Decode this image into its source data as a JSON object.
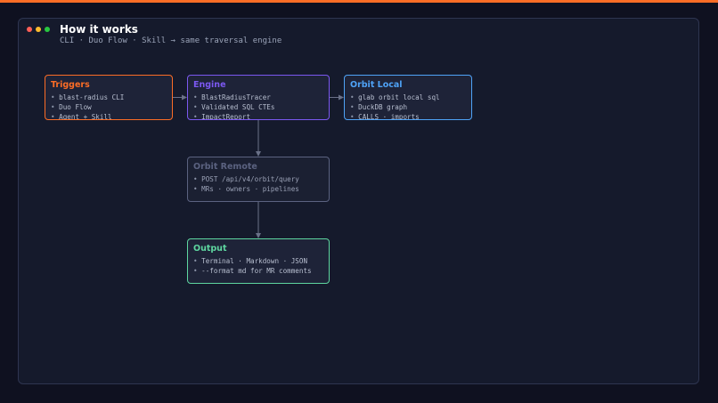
{
  "header": {
    "title": "How it works",
    "subtitle": "CLI · Duo Flow · Skill → same traversal engine"
  },
  "window_dots": [
    {
      "name": "close-dot",
      "color": "#ff5f57"
    },
    {
      "name": "minimize-dot",
      "color": "#febc2e"
    },
    {
      "name": "maximize-dot",
      "color": "#28c840"
    }
  ],
  "nodes": {
    "triggers": {
      "title": "Triggers",
      "color": "#fc6d26",
      "items": [
        "blast-radius CLI",
        "Duo Flow",
        "Agent + Skill"
      ]
    },
    "engine": {
      "title": "Engine",
      "color": "#7b58f0",
      "items": [
        "BlastRadiusTracer",
        "Validated SQL CTEs",
        "ImpactReport"
      ]
    },
    "orbit_local": {
      "title": "Orbit Local",
      "color": "#4fa3f7",
      "items": [
        "glab orbit local sql",
        "DuckDB graph",
        "CALLS · imports"
      ]
    },
    "orbit_remote": {
      "title": "Orbit Remote",
      "color": "#5b6280",
      "items": [
        "POST /api/v4/orbit/query",
        "MRs · owners · pipelines"
      ]
    },
    "output": {
      "title": "Output",
      "color": "#5ed6a0",
      "items": [
        "Terminal · Markdown · JSON",
        "--format md for MR comments"
      ]
    }
  },
  "edges": [
    {
      "from": "triggers",
      "to": "engine"
    },
    {
      "from": "engine",
      "to": "orbit_local"
    },
    {
      "from": "engine",
      "to": "orbit_remote"
    },
    {
      "from": "orbit_remote",
      "to": "output"
    }
  ]
}
